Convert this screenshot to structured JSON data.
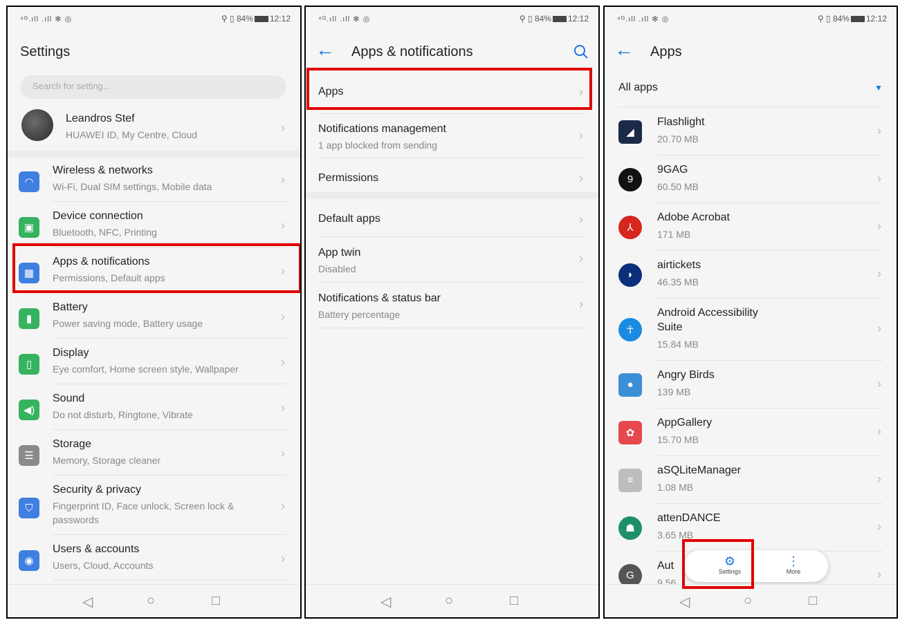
{
  "status": {
    "left": "⁴ᴳ.ıll .ıll ✻ ◎",
    "right_loc": "⚲ ▯",
    "battery": "84%",
    "time": "12:12"
  },
  "nav": {
    "back": "◁",
    "home": "○",
    "recent": "□"
  },
  "panel1": {
    "title": "Settings",
    "search_placeholder": "Search for setting...",
    "account": {
      "name": "Leandros Stef",
      "sub": "HUAWEI ID, My Centre, Cloud"
    },
    "items": [
      {
        "title": "Wireless & networks",
        "sub": "Wi-Fi, Dual SIM settings, Mobile data",
        "icon": "wifi-icon",
        "color": "#3f7fe0"
      },
      {
        "title": "Device connection",
        "sub": "Bluetooth, NFC, Printing",
        "icon": "device-connection-icon",
        "color": "#35b35f"
      },
      {
        "title": "Apps & notifications",
        "sub": "Permissions, Default apps",
        "icon": "apps-icon",
        "color": "#3f7fe0"
      },
      {
        "title": "Battery",
        "sub": "Power saving mode, Battery usage",
        "icon": "battery-icon",
        "color": "#35b35f"
      },
      {
        "title": "Display",
        "sub": "Eye comfort, Home screen style, Wallpaper",
        "icon": "display-icon",
        "color": "#35b35f"
      },
      {
        "title": "Sound",
        "sub": "Do not disturb, Ringtone, Vibrate",
        "icon": "sound-icon",
        "color": "#35b35f"
      },
      {
        "title": "Storage",
        "sub": "Memory, Storage cleaner",
        "icon": "storage-icon",
        "color": "#8a8a8a"
      },
      {
        "title": "Security & privacy",
        "sub": "Fingerprint ID, Face unlock, Screen lock &",
        "sub2": "passwords",
        "icon": "shield-icon",
        "color": "#3f7fe0"
      },
      {
        "title": "Users & accounts",
        "sub": "Users, Cloud, Accounts",
        "icon": "user-icon",
        "color": "#3f7fe0"
      }
    ]
  },
  "panel2": {
    "title": "Apps & notifications",
    "items": [
      {
        "title": "Apps",
        "sub": ""
      },
      {
        "title": "Notifications management",
        "sub": "1 app blocked from sending"
      },
      {
        "title": "Permissions",
        "sub": ""
      },
      {
        "title": "Default apps",
        "sub": ""
      },
      {
        "title": "App twin",
        "sub": "Disabled"
      },
      {
        "title": "Notifications & status bar",
        "sub": "Battery percentage"
      }
    ]
  },
  "panel3": {
    "title": "Apps",
    "filter": "All apps",
    "apps": [
      {
        "name": "Flashlight",
        "size": "20.70 MB",
        "icon": "flashlight-icon",
        "color": "#1c2a4a"
      },
      {
        "name": "9GAG",
        "size": "60.50 MB",
        "icon": "9gag-icon",
        "color": "#111111"
      },
      {
        "name": "Adobe Acrobat",
        "size": "171 MB",
        "icon": "acrobat-icon",
        "color": "#d6261d"
      },
      {
        "name": "airtickets",
        "size": "46.35 MB",
        "icon": "airtickets-icon",
        "color": "#0b2f7a"
      },
      {
        "name": "Android Accessibility",
        "name2": "Suite",
        "size": "15.84 MB",
        "icon": "accessibility-icon",
        "color": "#1a8be0"
      },
      {
        "name": "Angry Birds",
        "size": "139 MB",
        "icon": "angry-birds-icon",
        "color": "#3b8fd6"
      },
      {
        "name": "AppGallery",
        "size": "15.70 MB",
        "icon": "appgallery-icon",
        "color": "#e5484d"
      },
      {
        "name": "aSQLiteManager",
        "size": "1.08 MB",
        "icon": "database-icon",
        "color": "#bdbdbd"
      },
      {
        "name": "attenDANCE",
        "size": "3.65 MB",
        "icon": "android-icon",
        "color": "#1f8f6a"
      },
      {
        "name": "Aut",
        "size": "9.56",
        "icon": "auto-icon",
        "color": "#555555"
      }
    ],
    "popup": {
      "settings": "Settings",
      "more": "More"
    }
  }
}
